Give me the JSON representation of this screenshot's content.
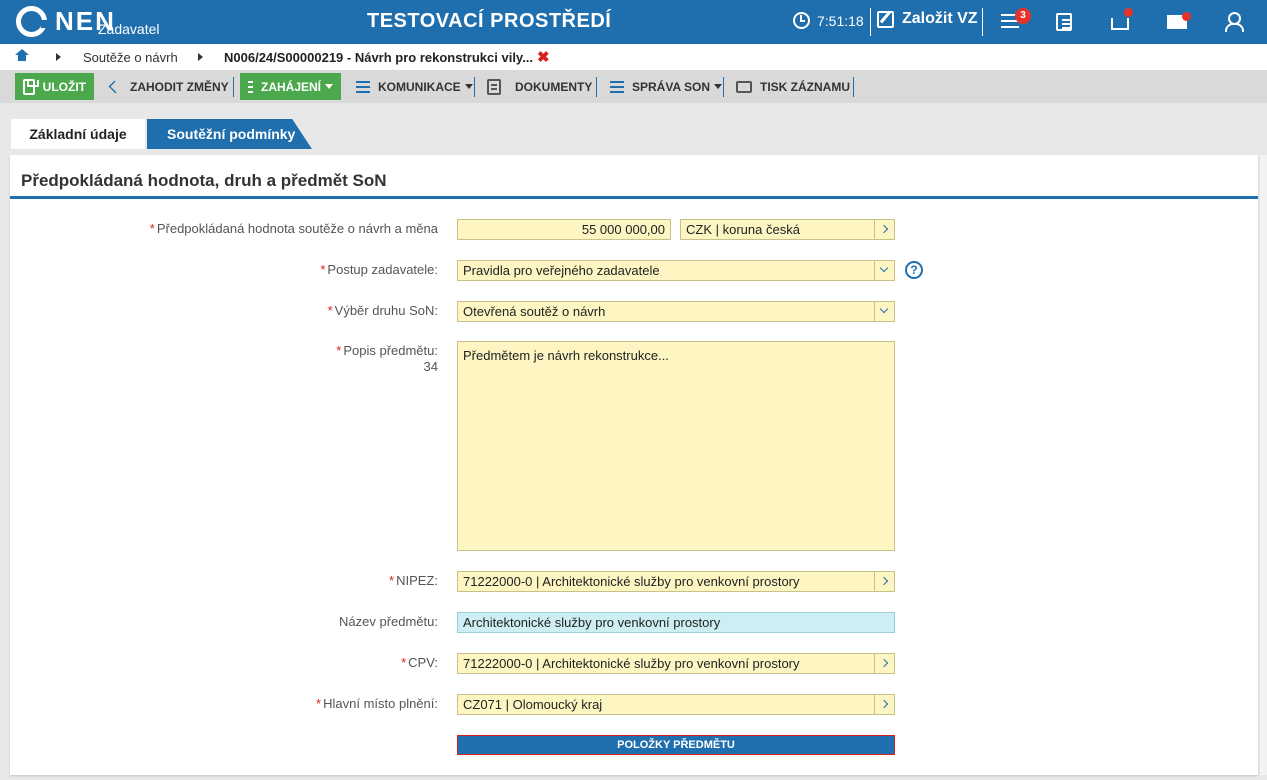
{
  "header": {
    "logo_text": "NEN",
    "logo_sub": "Zadavatel",
    "env_title": "TESTOVACÍ PROSTŘEDÍ",
    "time": "7:51:18",
    "create_label": "Založit VZ",
    "menu_badge": "3",
    "accent": "#1f6fae",
    "alert_color": "#e5332a"
  },
  "breadcrumb": {
    "item1": "Soutěže o návrh",
    "item2": "N006/24/S00000219 - Návrh pro rekonstrukci vily...",
    "close": "✖"
  },
  "toolbar": {
    "save": "ULOŽIT",
    "discard": "ZAHODIT ZMĚNY",
    "start": "ZAHÁJENÍ",
    "communication": "KOMUNIKACE",
    "documents": "DOKUMENTY",
    "manage": "SPRÁVA SON",
    "print": "TISK ZÁZNAMU"
  },
  "tabs": [
    {
      "label": "Základní údaje",
      "active": true
    },
    {
      "label": "Soutěžní podmínky",
      "active": false
    }
  ],
  "section": {
    "title": "Předpokládaná hodnota, druh a předmět SoN"
  },
  "form": {
    "value_label": "Předpokládaná hodnota soutěže o návrh a měna",
    "value": "55 000 000,00",
    "currency": "CZK | koruna česká",
    "procedure_label": "Postup zadavatele:",
    "procedure": "Pravidla pro veřejného zadavatele",
    "type_label": "Výběr druhu SoN:",
    "type": "Otevřená soutěž o návrh",
    "desc_label": "Popis předmětu:",
    "desc_count": "34",
    "desc": "Předmětem je návrh rekonstrukce...",
    "nipez_label": "NIPEZ:",
    "nipez": "71222000-0 | Architektonické služby pro venkovní prostory",
    "name_label": "Název předmětu:",
    "name": "Architektonické služby pro venkovní prostory",
    "cpv_label": "CPV:",
    "cpv": "71222000-0 | Architektonické služby pro venkovní prostory",
    "place_label": "Hlavní místo plnění:",
    "place": "CZ071 | Olomoucký kraj",
    "items_button": "POLOŽKY PŘEDMĚTU",
    "required_mark": "*",
    "help": "?"
  }
}
